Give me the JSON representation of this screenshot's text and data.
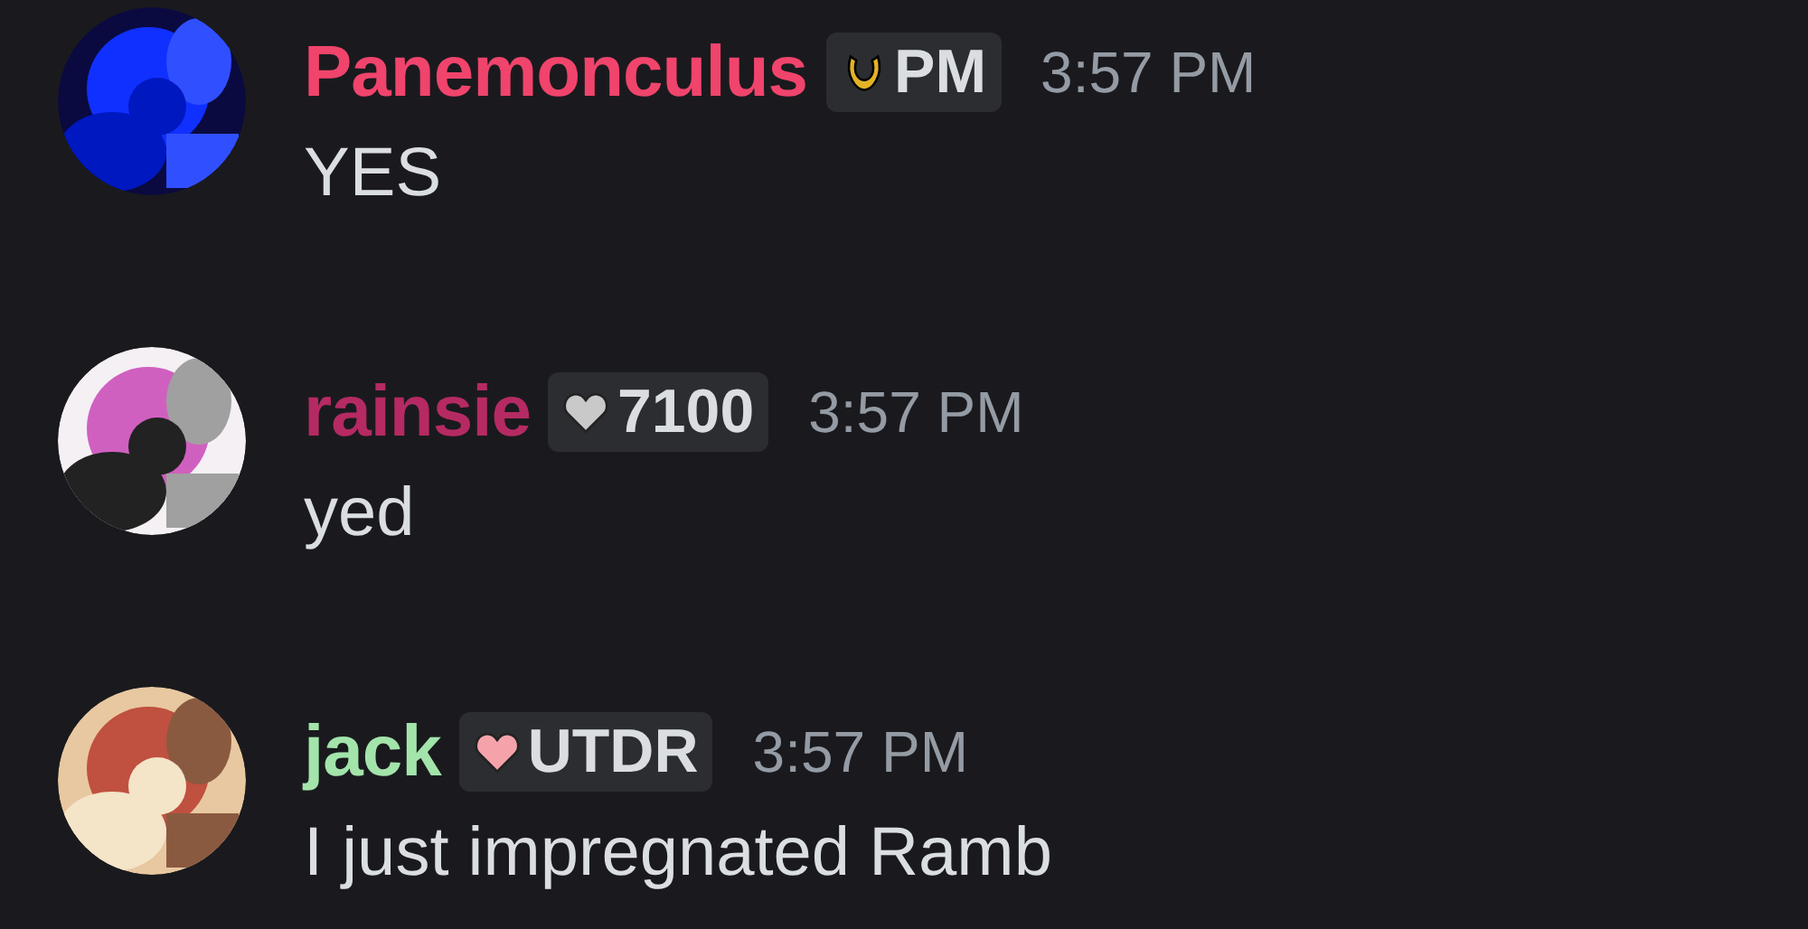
{
  "messages": [
    {
      "author": "Panemonculus",
      "color": "#f0446c",
      "badge": {
        "kind": "moon",
        "color": "#e3b325",
        "label": "PM"
      },
      "time": "3:57 PM",
      "text": "YES"
    },
    {
      "author": "rainsie",
      "color": "#b52a62",
      "badge": {
        "kind": "heart",
        "color": "#c9c9c9",
        "label": "7100"
      },
      "time": "3:57 PM",
      "text": "yed"
    },
    {
      "author": "jack",
      "color": "#a3e4ab",
      "badge": {
        "kind": "heart",
        "color": "#f5a3ab",
        "label": "UTDR"
      },
      "time": "3:57 PM",
      "text": "I just impregnated Ramb"
    }
  ]
}
